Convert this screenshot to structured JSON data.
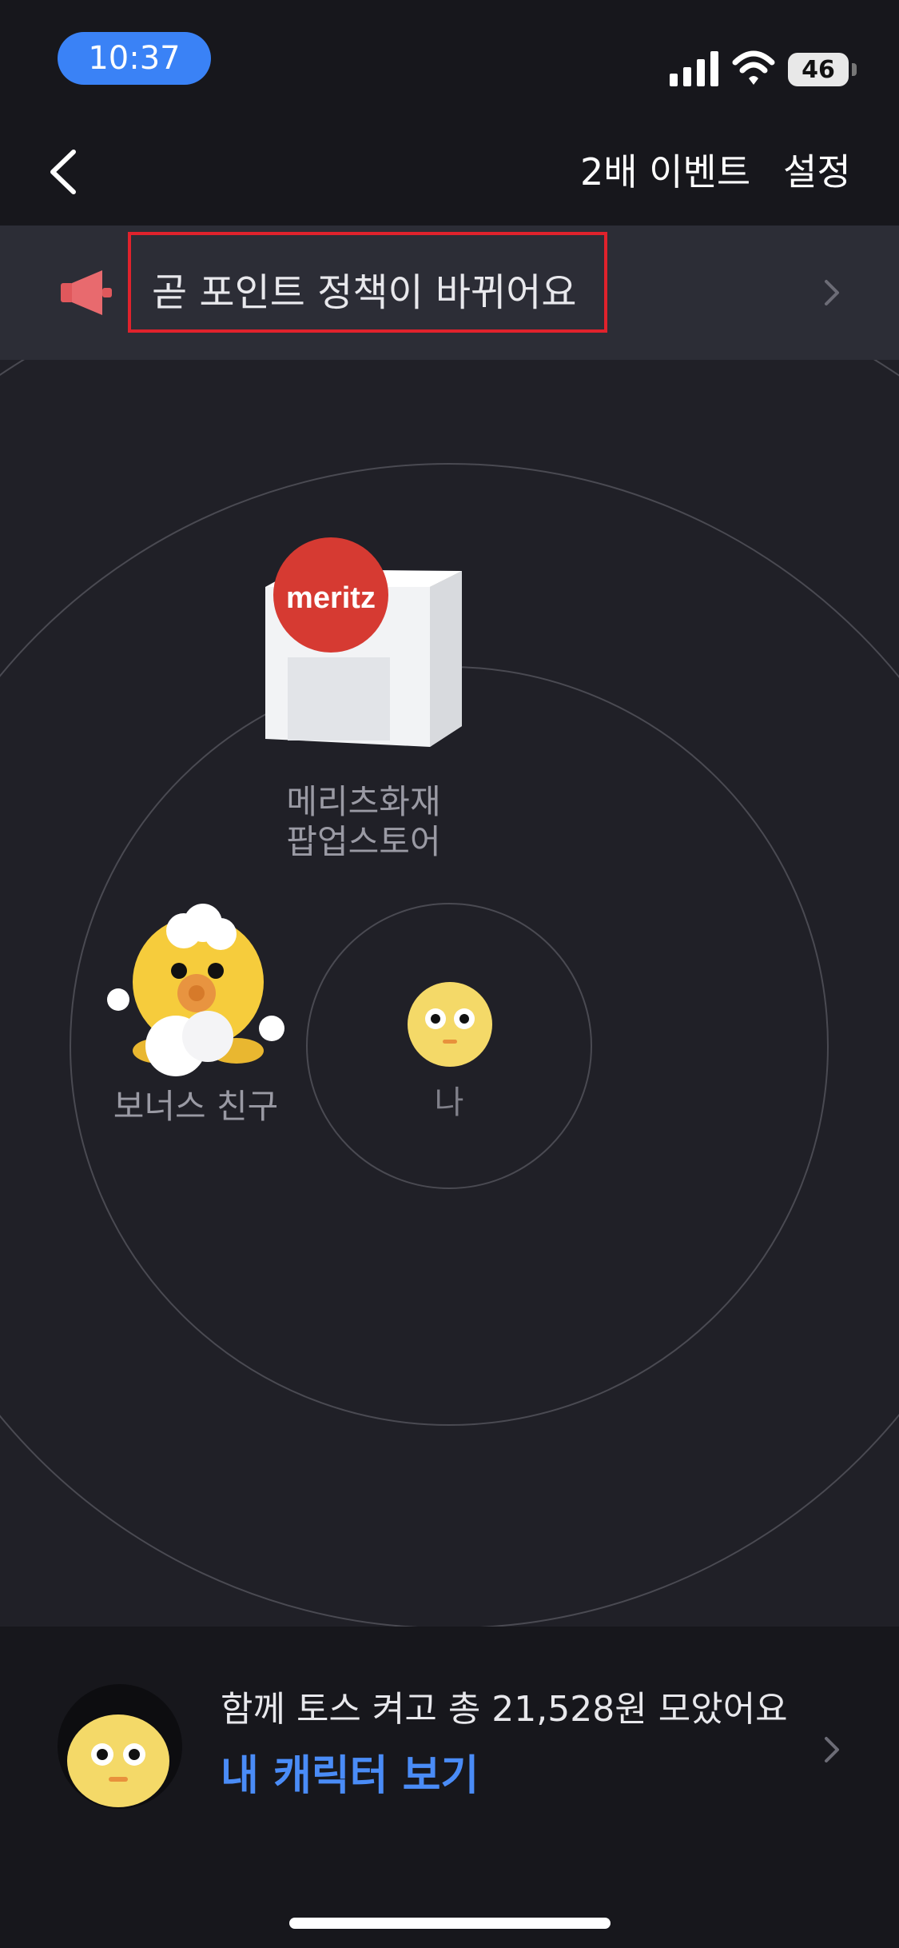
{
  "status_bar": {
    "time": "10:37",
    "battery": "46",
    "icons": [
      "signal-icon",
      "wifi-icon",
      "battery-icon"
    ]
  },
  "nav": {
    "back_icon": "chevron-left-icon",
    "event_label": "2배 이벤트",
    "settings_label": "설정"
  },
  "notice": {
    "icon": "megaphone-icon",
    "text": "곧 포인트 정책이 바뀌어요",
    "chevron_icon": "chevron-right-icon",
    "highlight_color": "#e0222c"
  },
  "radar": {
    "store": {
      "badge_text": "meritz",
      "label_line1": "메리츠화재",
      "label_line2": "팝업스토어"
    },
    "friend": {
      "label": "보너스 친구"
    },
    "me": {
      "label": "나"
    }
  },
  "bottom": {
    "summary": "함께 토스 켜고 총 21,528원 모았어요",
    "link": "내 캐릭터 보기",
    "link_color": "#4a8cf7",
    "chevron_icon": "chevron-right-icon"
  }
}
